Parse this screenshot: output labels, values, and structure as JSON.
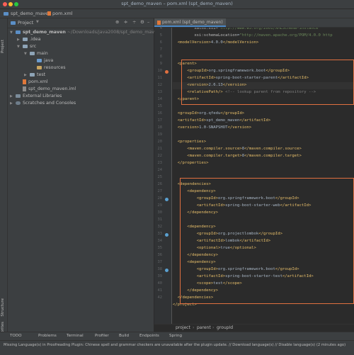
{
  "window": {
    "title": "spt_demo_maven – pom.xml (spt_demo_maven)"
  },
  "nav": {
    "project": "spt_demo_maven",
    "file": "pom.xml"
  },
  "left_strip": {
    "project": "Project",
    "structure": "Structure",
    "favorites": "Favorites"
  },
  "project_panel": {
    "header": "Project",
    "tree": [
      {
        "label": "spt_demo_maven",
        "extra": "~/Downloads/java2008/spt_demo_maven"
      },
      {
        "label": ".idea"
      },
      {
        "label": "src"
      },
      {
        "label": "main"
      },
      {
        "label": "java"
      },
      {
        "label": "resources"
      },
      {
        "label": "test"
      },
      {
        "label": "pom.xml"
      },
      {
        "label": "spt_demo_maven.iml"
      },
      {
        "label": "External Libraries"
      },
      {
        "label": "Scratches and Consoles"
      }
    ]
  },
  "editor": {
    "tab": "pom.xml (spt_demo_maven)",
    "line_numbers": [
      "4",
      "5",
      "6",
      "7",
      "8",
      "9",
      "10",
      "11",
      "12",
      "13",
      "14",
      "15",
      "16",
      "17",
      "18",
      "19",
      "20",
      "21",
      "22",
      "23",
      "24",
      "25",
      "26",
      "27",
      "28",
      "29",
      "30",
      "31",
      "32",
      "33",
      "34",
      "35",
      "36",
      "37",
      "38",
      "39",
      "40",
      "41",
      "42"
    ],
    "breadcrumb": [
      "project",
      "parent",
      "groupId"
    ]
  },
  "bottom_tabs": [
    "TODO",
    "Problems",
    "Terminal",
    "Profiler",
    "Build",
    "Endpoints",
    "Spring"
  ],
  "status": {
    "text": "Missing Language(s) in Proofreading Plugin: Chinese spell and grammar checkers are unavailable after the plugin update. // Download language(s) // Disable language(s) (2 minutes ago)"
  },
  "colors": {
    "accent": "#4a88c7",
    "highlight_box": "#e07040",
    "tag": "#e8bf6a",
    "string": "#6a8759"
  },
  "icons": {
    "folder": "folder-icon",
    "maven": "maven-icon",
    "gear": "gear-icon"
  }
}
